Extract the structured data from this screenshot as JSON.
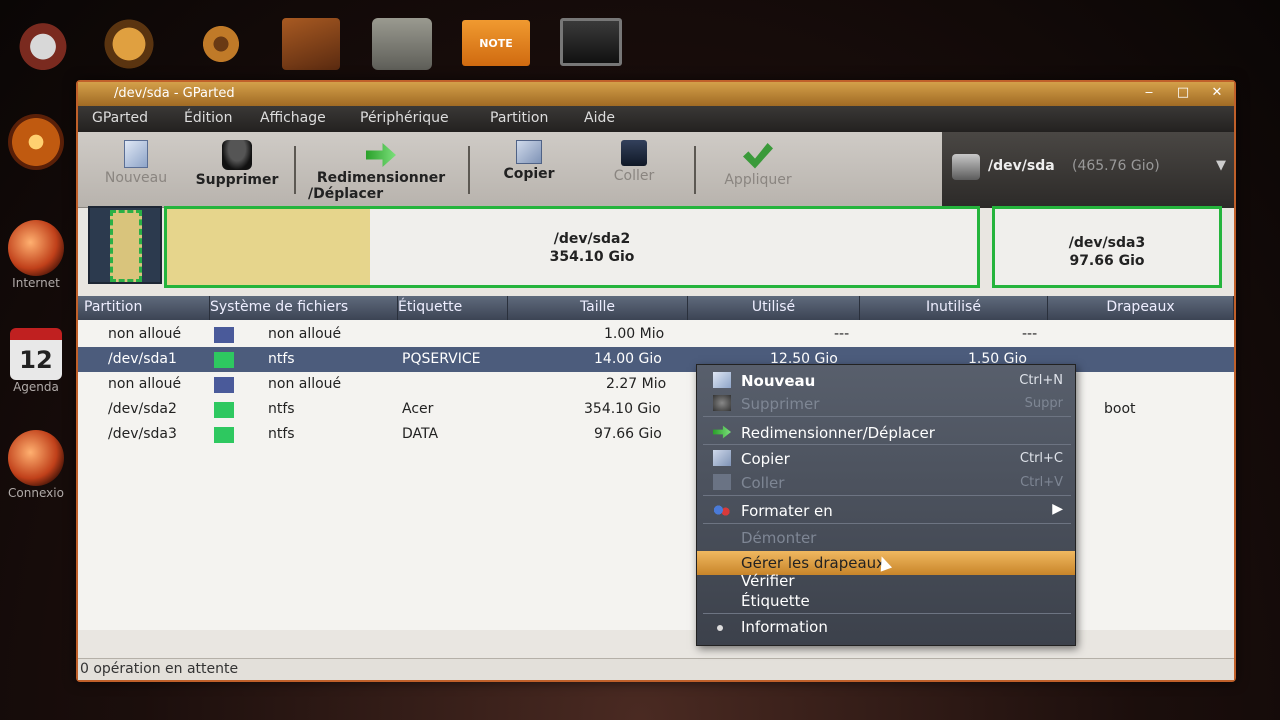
{
  "window": {
    "title": "/dev/sda - GParted"
  },
  "menubar": [
    "GParted",
    "Édition",
    "Affichage",
    "Périphérique",
    "Partition",
    "Aide"
  ],
  "toolbar": {
    "new": "Nouveau",
    "delete": "Supprimer",
    "resize_line1": "Redimensionner",
    "resize_line2": "/Déplacer",
    "copy": "Copier",
    "paste": "Coller",
    "apply": "Appliquer"
  },
  "device": {
    "name": "/dev/sda",
    "size": "(465.76 Gio)"
  },
  "disk_graphic": {
    "sda2_name": "/dev/sda2",
    "sda2_size": "354.10 Gio",
    "sda2_used_fraction": 0.25,
    "sda3_name": "/dev/sda3",
    "sda3_size": "97.66 Gio"
  },
  "table": {
    "headers": [
      "Partition",
      "Système de fichiers",
      "Étiquette",
      "Taille",
      "Utilisé",
      "Inutilisé",
      "Drapeaux"
    ],
    "rows": [
      {
        "partition": "non alloué",
        "fs": "non alloué",
        "label": "",
        "size": "1.00 Mio",
        "used": "---",
        "unused": "---",
        "color": "#4a5a9a"
      },
      {
        "partition": "/dev/sda1",
        "fs": "ntfs",
        "label": "PQSERVICE",
        "size": "14.00 Gio",
        "used": "12.50 Gio",
        "unused": "1.50 Gio",
        "color": "#2ec860"
      },
      {
        "partition": "non alloué",
        "fs": "non alloué",
        "label": "",
        "size": "2.27 Mio",
        "used": "",
        "unused": "",
        "color": "#4a5a9a"
      },
      {
        "partition": "/dev/sda2",
        "fs": "ntfs",
        "label": "Acer",
        "size": "354.10 Gio",
        "used": "",
        "unused": "",
        "flags": "boot",
        "color": "#2ec860"
      },
      {
        "partition": "/dev/sda3",
        "fs": "ntfs",
        "label": "DATA",
        "size": "97.66 Gio",
        "used": "",
        "unused": "",
        "color": "#2ec860"
      }
    ]
  },
  "status": "0 opération en attente",
  "context_menu": {
    "new": "Nouveau",
    "new_acc": "Ctrl+N",
    "delete": "Supprimer",
    "delete_acc": "Suppr",
    "resize": "Redimensionner/Déplacer",
    "copy": "Copier",
    "copy_acc": "Ctrl+C",
    "paste": "Coller",
    "paste_acc": "Ctrl+V",
    "format": "Formater en",
    "unmount": "Démonter",
    "flags": "Gérer les drapeaux",
    "check": "Vérifier",
    "label": "Étiquette",
    "info": "Information"
  },
  "dock": {
    "note": "NOTE",
    "left": [
      "",
      "Internet",
      "Agenda",
      "Connexio"
    ],
    "calendar_day": "12"
  }
}
